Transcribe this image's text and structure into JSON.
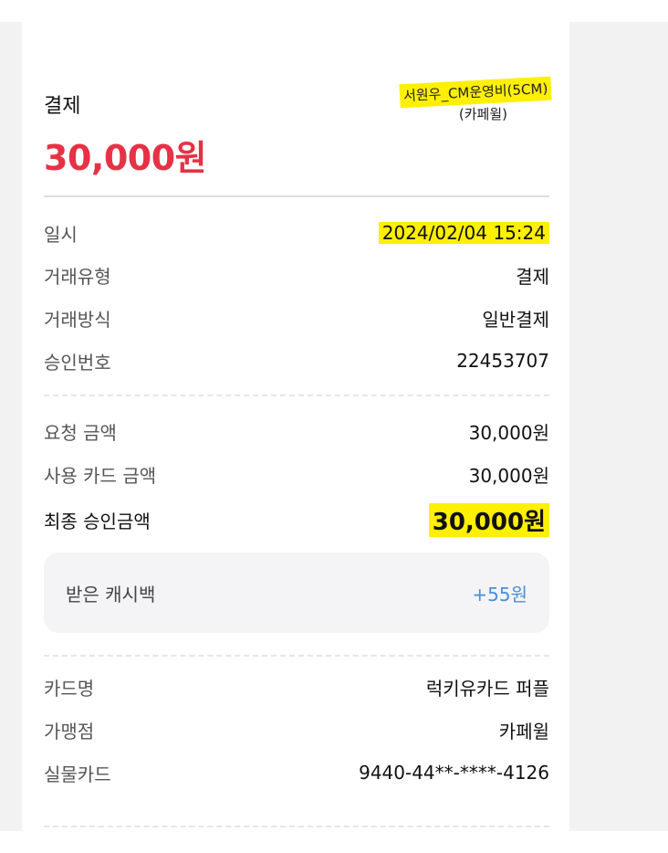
{
  "header": {
    "title": "결제",
    "amount": "30,000원",
    "merchant_line1": "서원우_CM운영비(5CM)",
    "merchant_line2": "(카페윌)"
  },
  "details": [
    {
      "label": "일시",
      "value": "2024/02/04 15:24"
    },
    {
      "label": "거래유형",
      "value": "결제"
    },
    {
      "label": "거래방식",
      "value": "일반결제"
    },
    {
      "label": "승인번호",
      "value": "22453707"
    }
  ],
  "amounts": [
    {
      "label": "요청 금액",
      "value": "30,000원"
    },
    {
      "label": "사용 카드 금액",
      "value": "30,000원"
    }
  ],
  "final": {
    "label": "최종 승인금액",
    "value": "30,000원"
  },
  "cashback": {
    "label": "받은 캐시백",
    "value": "+55원",
    "color": "#4a8edc"
  },
  "card": [
    {
      "label": "카드명",
      "value": "럭키유카드 퍼플"
    },
    {
      "label": "가맹점",
      "value": "카페윌"
    },
    {
      "label": "실물카드",
      "value": "9440-44**-****-4126"
    }
  ],
  "colors": {
    "amount": "#e63246",
    "highlight": "#ffef00"
  }
}
